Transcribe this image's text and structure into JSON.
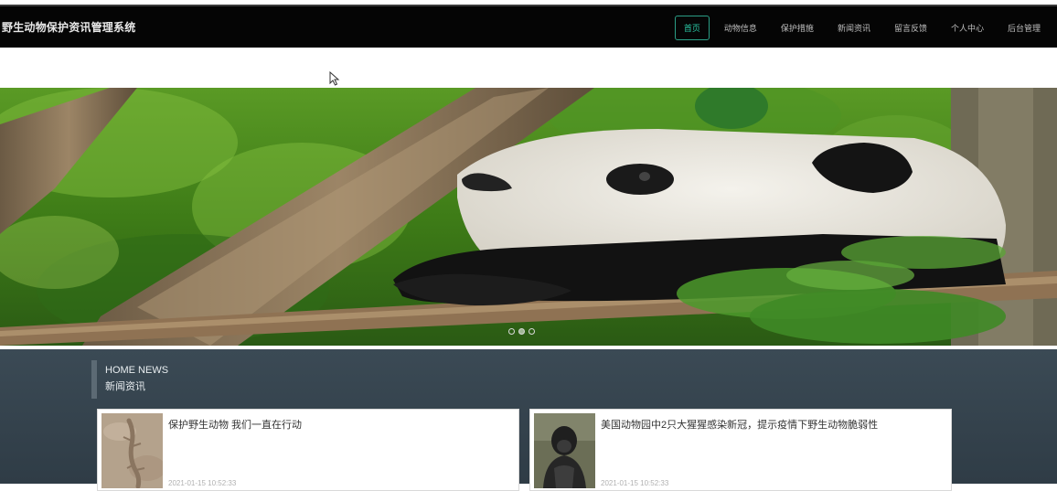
{
  "header": {
    "site_title": "野生动物保护资讯管理系统",
    "nav": [
      {
        "label": "首页",
        "active": true
      },
      {
        "label": "动物信息",
        "active": false
      },
      {
        "label": "保护措施",
        "active": false
      },
      {
        "label": "新闻资讯",
        "active": false
      },
      {
        "label": "留言反馈",
        "active": false
      },
      {
        "label": "个人中心",
        "active": false
      },
      {
        "label": "后台管理",
        "active": false
      }
    ],
    "active_color": "#2bc9a6"
  },
  "banner": {
    "image_subject": "giant panda resting on a tree branch",
    "slide_count": 3,
    "active_slide": 2
  },
  "news": {
    "heading_en": "HOME NEWS",
    "heading_zh": "新闻资讯",
    "items": [
      {
        "title": "保护野生动物 我们一直在行动",
        "date": "2021-01-15 10:52:33",
        "thumb": "lizard-on-sand"
      },
      {
        "title": "美国动物园中2只大猩猩感染新冠，提示疫情下野生动物脆弱性",
        "date": "2021-01-15 10:52:33",
        "thumb": "gorilla"
      }
    ]
  },
  "cursor_icon": "mouse-pointer-icon"
}
